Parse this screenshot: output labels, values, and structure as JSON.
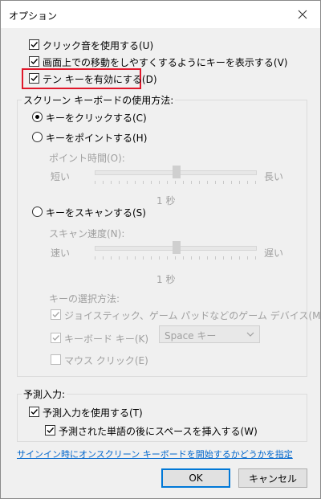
{
  "window": {
    "title": "オプション"
  },
  "options": {
    "click_sound": "クリック音を使用する(U)",
    "show_keys": "画面上での移動をしやすくするようにキーを表示する(V)",
    "numpad": "テン キーを有効にする(D)"
  },
  "screen_keyboard": {
    "group_title": "スクリーン キーボードの使用方法:",
    "click_keys": "キーをクリックする(C)",
    "hover_keys": "キーをポイントする(H)",
    "hover_duration_label": "ポイント時間(O):",
    "hover_short": "短い",
    "hover_long": "長い",
    "hover_value": "1 秒",
    "scan_keys": "キーをスキャンする(S)",
    "scan_speed_label": "スキャン速度(N):",
    "scan_fast": "速い",
    "scan_slow": "遅い",
    "scan_value": "1 秒",
    "key_selection_label": "キーの選択方法:",
    "joystick": "ジョイスティック、ゲーム パッドなどのゲーム デバイス(M)",
    "keyboard_key": "キーボード キー(K)",
    "keyboard_key_select": "Space キー",
    "mouse_click": "マウス クリック(E)"
  },
  "prediction": {
    "group_title": "予測入力:",
    "use_prediction": "予測入力を使用する(T)",
    "insert_space": "予測された単語の後にスペースを挿入する(W)"
  },
  "signin_link": "サインイン時にオンスクリーン キーボードを開始するかどうかを指定",
  "buttons": {
    "ok": "OK",
    "cancel": "キャンセル"
  },
  "state": {
    "click_sound": true,
    "show_keys": true,
    "numpad": true,
    "mode": "click",
    "joystick": true,
    "keyboard_key": true,
    "mouse_click": false,
    "use_prediction": true,
    "insert_space": true
  },
  "colors": {
    "highlight": "#e0182b",
    "link": "#0066cc",
    "accent": "#0078d7"
  }
}
